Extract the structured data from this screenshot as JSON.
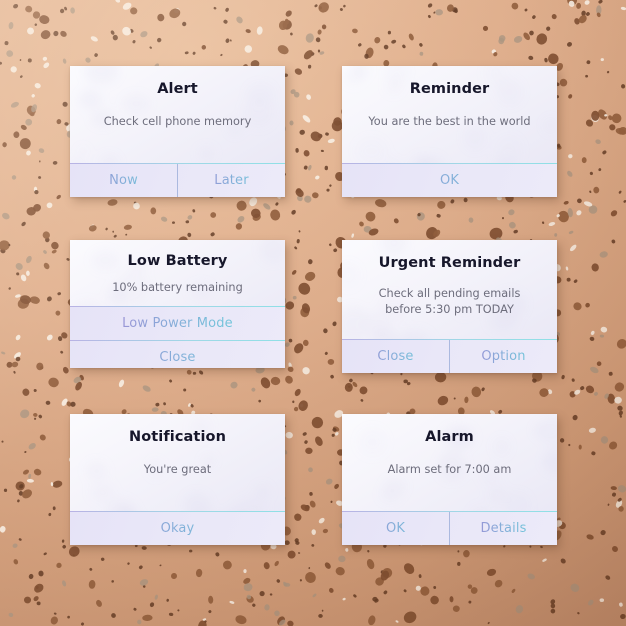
{
  "background": {
    "style": "terrazzo-speckle",
    "base_color": "#dfae8c",
    "light_corner": "#e8bd9b",
    "dark_corner": "#c08c6c",
    "speckle_colors": [
      "#7b4a2c",
      "#8d5a38",
      "#a8937f",
      "#f7efe6",
      "#5d3620"
    ]
  },
  "theme": {
    "card_bg_top": "#fbfbfe",
    "card_bg_bottom": "#e7e5f4",
    "action_bg": "#e9e7f8",
    "title_color": "#17172b",
    "message_color": "#6d6d7c",
    "button_gradient_start": "#8f87cf",
    "button_gradient_end": "#63cfdc",
    "divider_color": "#9fd8e6"
  },
  "cards": [
    {
      "id": "alert",
      "title": "Alert",
      "message": "Check cell phone memory",
      "layout": "row",
      "buttons": [
        {
          "label": "Now"
        },
        {
          "label": "Later"
        }
      ]
    },
    {
      "id": "reminder",
      "title": "Reminder",
      "message": "You are the best in the world",
      "layout": "row",
      "buttons": [
        {
          "label": "OK"
        }
      ]
    },
    {
      "id": "low-battery",
      "title": "Low Battery",
      "message": "10% battery remaining",
      "layout": "stacked",
      "buttons": [
        {
          "label": "Low Power Mode"
        },
        {
          "label": "Close"
        }
      ]
    },
    {
      "id": "urgent-reminder",
      "title": "Urgent Reminder",
      "message": "Check all pending emails\nbefore 5:30 pm TODAY",
      "layout": "row",
      "buttons": [
        {
          "label": "Close"
        },
        {
          "label": "Option"
        }
      ]
    },
    {
      "id": "notification",
      "title": "Notification",
      "message": "You're great",
      "layout": "row",
      "buttons": [
        {
          "label": "Okay"
        }
      ]
    },
    {
      "id": "alarm",
      "title": "Alarm",
      "message": "Alarm set for 7:00 am",
      "layout": "row",
      "buttons": [
        {
          "label": "OK"
        },
        {
          "label": "Details"
        }
      ]
    }
  ]
}
